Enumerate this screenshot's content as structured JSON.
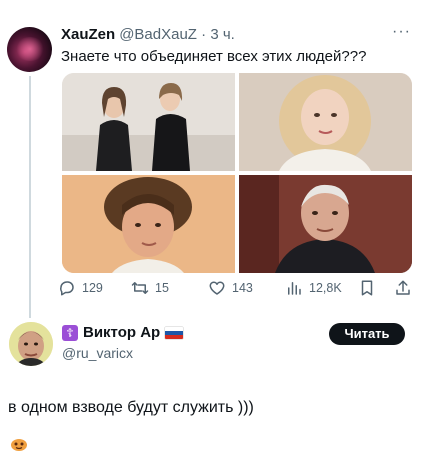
{
  "tweet": {
    "display_name": "XauZen",
    "handle": "@BadXauZ",
    "time": "3 ч.",
    "more_icon": "more-horizontal-icon",
    "text": "Знаете что объединяет всех этих людей???",
    "photos": [
      "photo-1",
      "photo-2",
      "photo-3",
      "photo-4"
    ],
    "stats": {
      "replies": "129",
      "retweets": "15",
      "likes": "143",
      "views": "12,8K"
    }
  },
  "reply_card": {
    "display_name": "Виктор Ар",
    "handle": "@ru_varicx",
    "follow_label": "Читать",
    "text": "в одном взводе будут служить )))"
  },
  "colors": {
    "text": "#0f1419",
    "secondary": "#536471",
    "thread_line": "#cfd9de",
    "button_bg": "#0f1419"
  }
}
